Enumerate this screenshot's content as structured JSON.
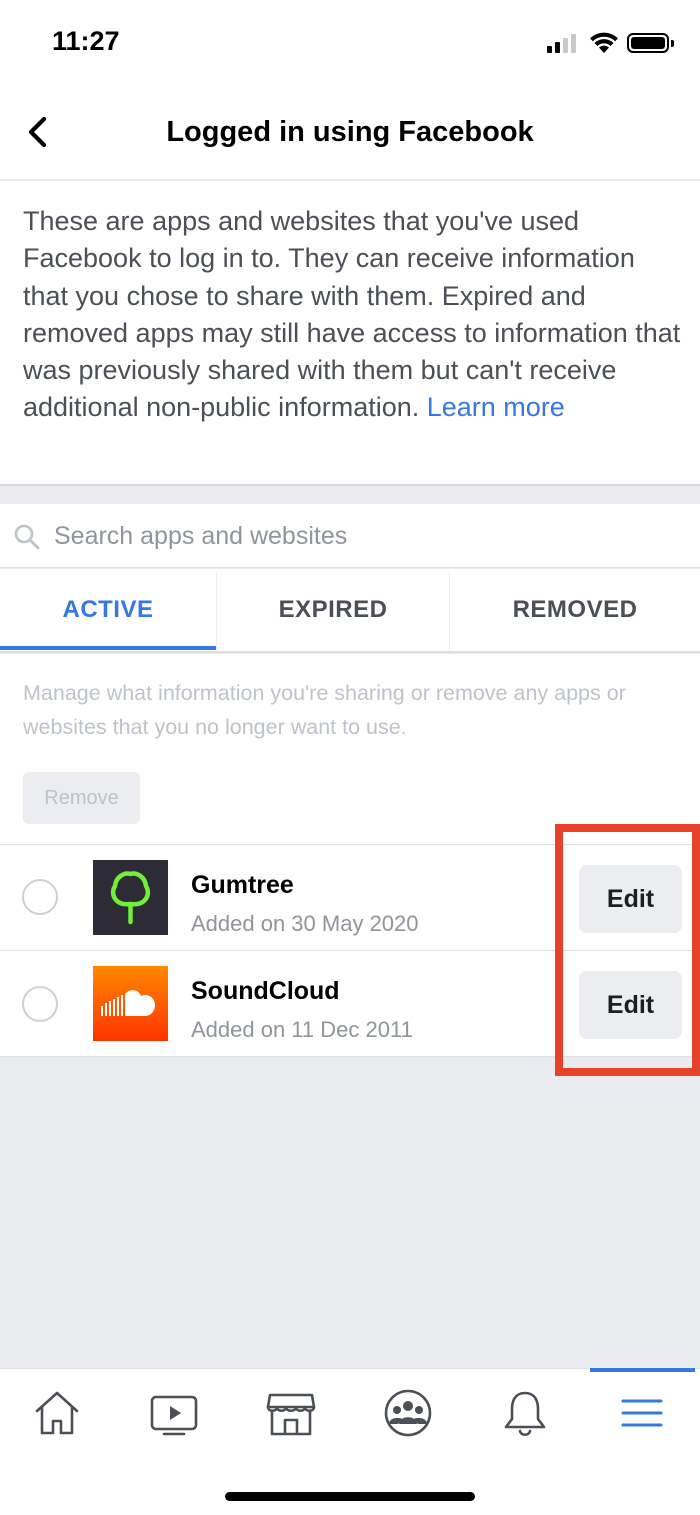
{
  "status_bar": {
    "time": "11:27"
  },
  "header": {
    "title": "Logged in using Facebook"
  },
  "intro": {
    "text": "These are apps and websites that you've used Facebook to log in to. They can receive information that you chose to share with them. Expired and removed apps may still have access to information that was previously shared with them but can't receive additional non-public information. ",
    "learn_more": "Learn more"
  },
  "search": {
    "placeholder": "Search apps and websites",
    "value": ""
  },
  "tabs": [
    {
      "label": "ACTIVE",
      "active": true
    },
    {
      "label": "EXPIRED",
      "active": false
    },
    {
      "label": "REMOVED",
      "active": false
    }
  ],
  "manage": {
    "text": "Manage what information you're sharing or remove any apps or websites that you no longer want to use.",
    "remove_label": "Remove"
  },
  "apps": [
    {
      "name": "Gumtree",
      "added": "Added on 30 May 2020",
      "edit_label": "Edit",
      "icon": "gumtree-tree-icon"
    },
    {
      "name": "SoundCloud",
      "added": "Added on 11 Dec 2011",
      "edit_label": "Edit",
      "icon": "soundcloud-cloud-icon"
    }
  ],
  "bottom_nav": [
    {
      "icon": "home-icon"
    },
    {
      "icon": "watch-video-icon"
    },
    {
      "icon": "marketplace-icon"
    },
    {
      "icon": "groups-icon"
    },
    {
      "icon": "notifications-bell-icon"
    },
    {
      "icon": "menu-icon",
      "active": true
    }
  ],
  "colors": {
    "accent": "#3578e5",
    "highlight": "#e8412c",
    "gumtree_bg": "#2d2b36",
    "gumtree_green": "#72ef36",
    "soundcloud_orange": "#ff5500"
  }
}
